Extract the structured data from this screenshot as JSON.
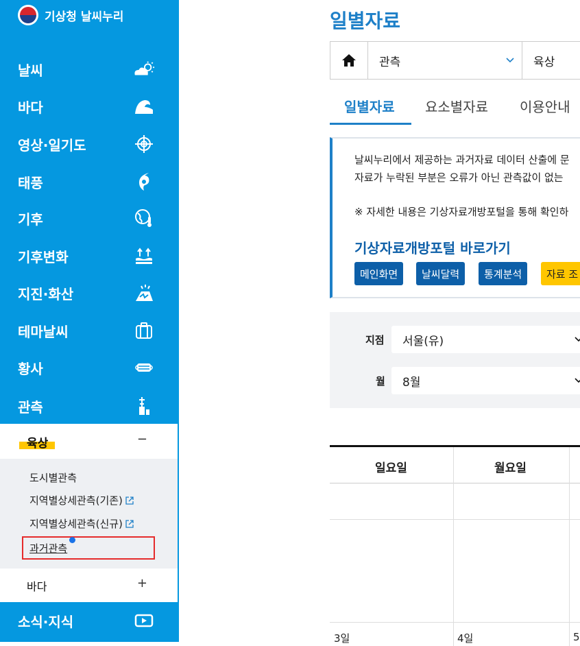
{
  "brand": {
    "name": "기상청 날씨누리"
  },
  "sidebar": {
    "menu": [
      {
        "label": "날씨",
        "icon": "weather-cloud-sun-icon"
      },
      {
        "label": "바다",
        "icon": "wave-icon"
      },
      {
        "label": "영상·일기도",
        "icon": "crosshair-icon"
      },
      {
        "label": "태풍",
        "icon": "typhoon-icon"
      },
      {
        "label": "기후",
        "icon": "globe-thermometer-icon"
      },
      {
        "label": "기후변화",
        "icon": "rising-water-icon"
      },
      {
        "label": "지진·화산",
        "icon": "volcano-icon"
      },
      {
        "label": "테마날씨",
        "icon": "suitcase-icon"
      },
      {
        "label": "황사",
        "icon": "mask-icon"
      },
      {
        "label": "관측",
        "icon": "tower-icon"
      }
    ],
    "submenu": {
      "head_label": "육상",
      "head_sign": "−",
      "items": [
        {
          "label": "도시별관측",
          "external": false
        },
        {
          "label": "지역별상세관측(기존)",
          "external": true
        },
        {
          "label": "지역별상세관측(신규)",
          "external": true
        },
        {
          "label": "과거관측",
          "external": false
        }
      ],
      "sea_label": "바다",
      "sea_sign": "+"
    },
    "bottom": {
      "label": "소식·지식",
      "icon": "play-icon"
    }
  },
  "main": {
    "title": "일별자료",
    "breadcrumb": {
      "level1": "관측",
      "level2": "육상"
    },
    "tabs": [
      "일별자료",
      "요소별자료",
      "이용안내"
    ],
    "notice": {
      "line1": "날씨누리에서 제공하는 과거자료 데이터 산출에 문",
      "line2": "자료가 누락된 부분은 오류가 아닌 관측값이 없는",
      "line3": "※ 자세한 내용은 기상자료개방포털을 통해 확인하",
      "link_title": "기상자료개방포털 바로가기",
      "buttons": [
        "메인화면",
        "날씨달력",
        "통계분석",
        "자료 조"
      ]
    },
    "filter": {
      "station_label": "지점",
      "station_value": "서울(유)",
      "month_label": "월",
      "month_value": "8월"
    },
    "calendar": {
      "headers": [
        "일요일",
        "월요일"
      ],
      "days": [
        "3일",
        "4일",
        "5"
      ]
    }
  },
  "colors": {
    "sidebar": "#0598e0",
    "accent": "#1e80c8",
    "highlight": "#ffc600",
    "button": "#0d5fa8"
  }
}
